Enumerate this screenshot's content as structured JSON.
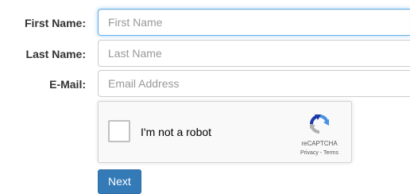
{
  "form": {
    "first_name": {
      "label": "First Name:",
      "placeholder": "First Name",
      "value": ""
    },
    "last_name": {
      "label": "Last Name:",
      "placeholder": "Last Name",
      "value": ""
    },
    "email": {
      "label": "E-Mail:",
      "placeholder": "Email Address",
      "value": ""
    }
  },
  "recaptcha": {
    "label": "I'm not a robot",
    "brand": "reCAPTCHA",
    "privacy": "Privacy",
    "separator": " - ",
    "terms": "Terms",
    "checked": false,
    "logo_icon": "recaptcha-logo-icon",
    "logo_colors": {
      "blue": "#4a90e2",
      "dark_blue": "#1c3aa9",
      "gray": "#b0b0b0"
    }
  },
  "actions": {
    "next_label": "Next",
    "button_color": "#337ab7"
  }
}
